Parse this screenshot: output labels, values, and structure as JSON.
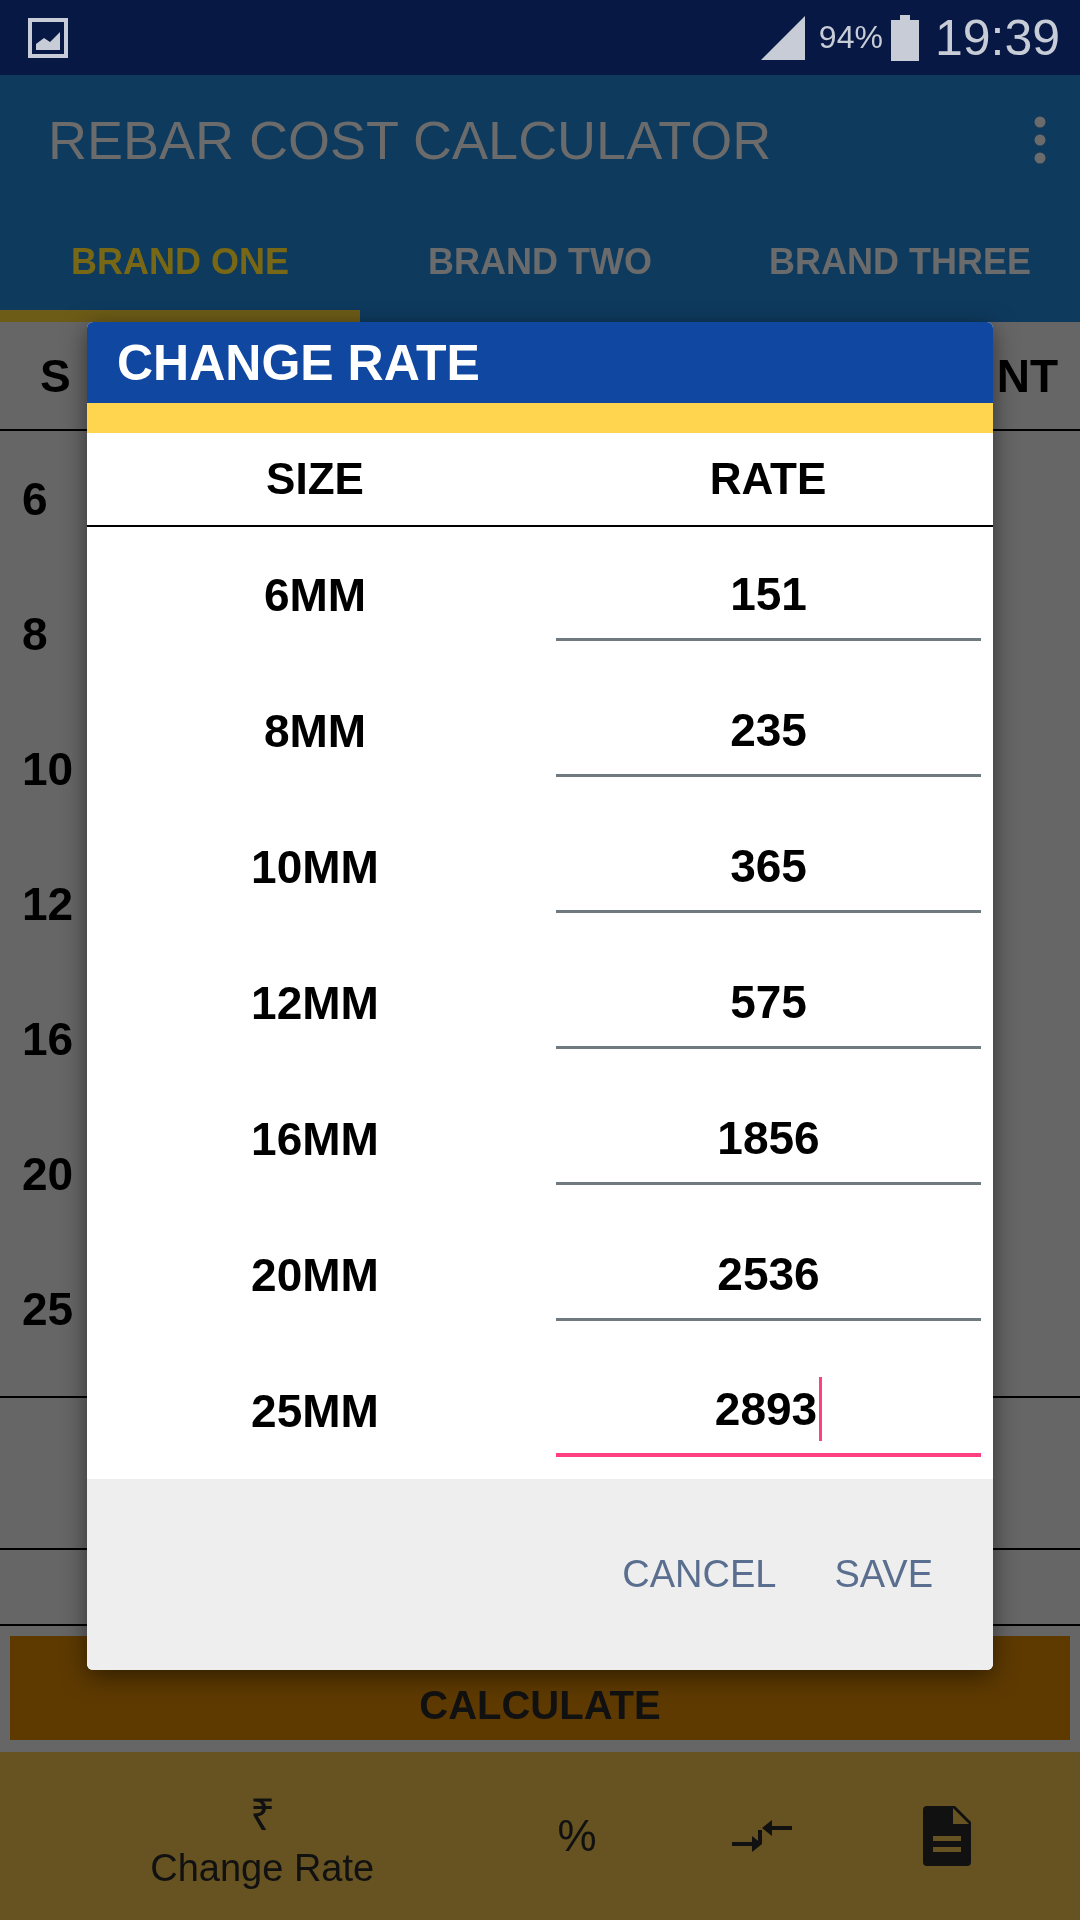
{
  "status_bar": {
    "battery": "94%",
    "time": "19:39"
  },
  "app_bar": {
    "title": "REBAR COST CALCULATOR"
  },
  "tabs": [
    {
      "label": "BRAND ONE",
      "selected": true
    },
    {
      "label": "BRAND TWO",
      "selected": false
    },
    {
      "label": "BRAND THREE",
      "selected": false
    }
  ],
  "table": {
    "header_left": "S",
    "header_right": "NT",
    "rows": [
      "6",
      "8",
      "10",
      "12",
      "16",
      "20",
      "25"
    ]
  },
  "calculate_button": "CALCULATE",
  "bottom_nav": [
    {
      "kind": "glyph",
      "symbol": "₹",
      "label": "Change Rate"
    },
    {
      "kind": "glyph",
      "symbol": "%"
    },
    {
      "kind": "compress"
    },
    {
      "kind": "document"
    }
  ],
  "dialog": {
    "title": "CHANGE RATE",
    "columns": [
      "SIZE",
      "RATE"
    ],
    "rows": [
      {
        "size": "6MM",
        "rate": "151",
        "focused": false
      },
      {
        "size": "8MM",
        "rate": "235",
        "focused": false
      },
      {
        "size": "10MM",
        "rate": "365",
        "focused": false
      },
      {
        "size": "12MM",
        "rate": "575",
        "focused": false
      },
      {
        "size": "16MM",
        "rate": "1856",
        "focused": false
      },
      {
        "size": "20MM",
        "rate": "2536",
        "focused": false
      },
      {
        "size": "25MM",
        "rate": "2893",
        "focused": true
      }
    ],
    "buttons": [
      "CANCEL",
      "SAVE"
    ]
  }
}
